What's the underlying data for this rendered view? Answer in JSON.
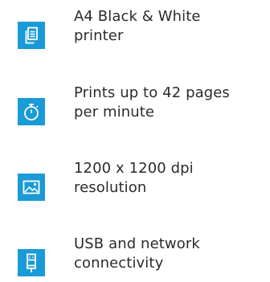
{
  "accent_color": "#1a9ad6",
  "features": [
    {
      "icon": "document-copies-icon",
      "line1": "A4 Black & White",
      "line2": "printer"
    },
    {
      "icon": "stopwatch-icon",
      "line1": "Prints up to 42 pages",
      "line2": "per minute"
    },
    {
      "icon": "image-icon",
      "line1": "1200 x 1200 dpi",
      "line2": "resolution"
    },
    {
      "icon": "usb-plug-icon",
      "line1": "USB and network",
      "line2": "connectivity"
    }
  ]
}
